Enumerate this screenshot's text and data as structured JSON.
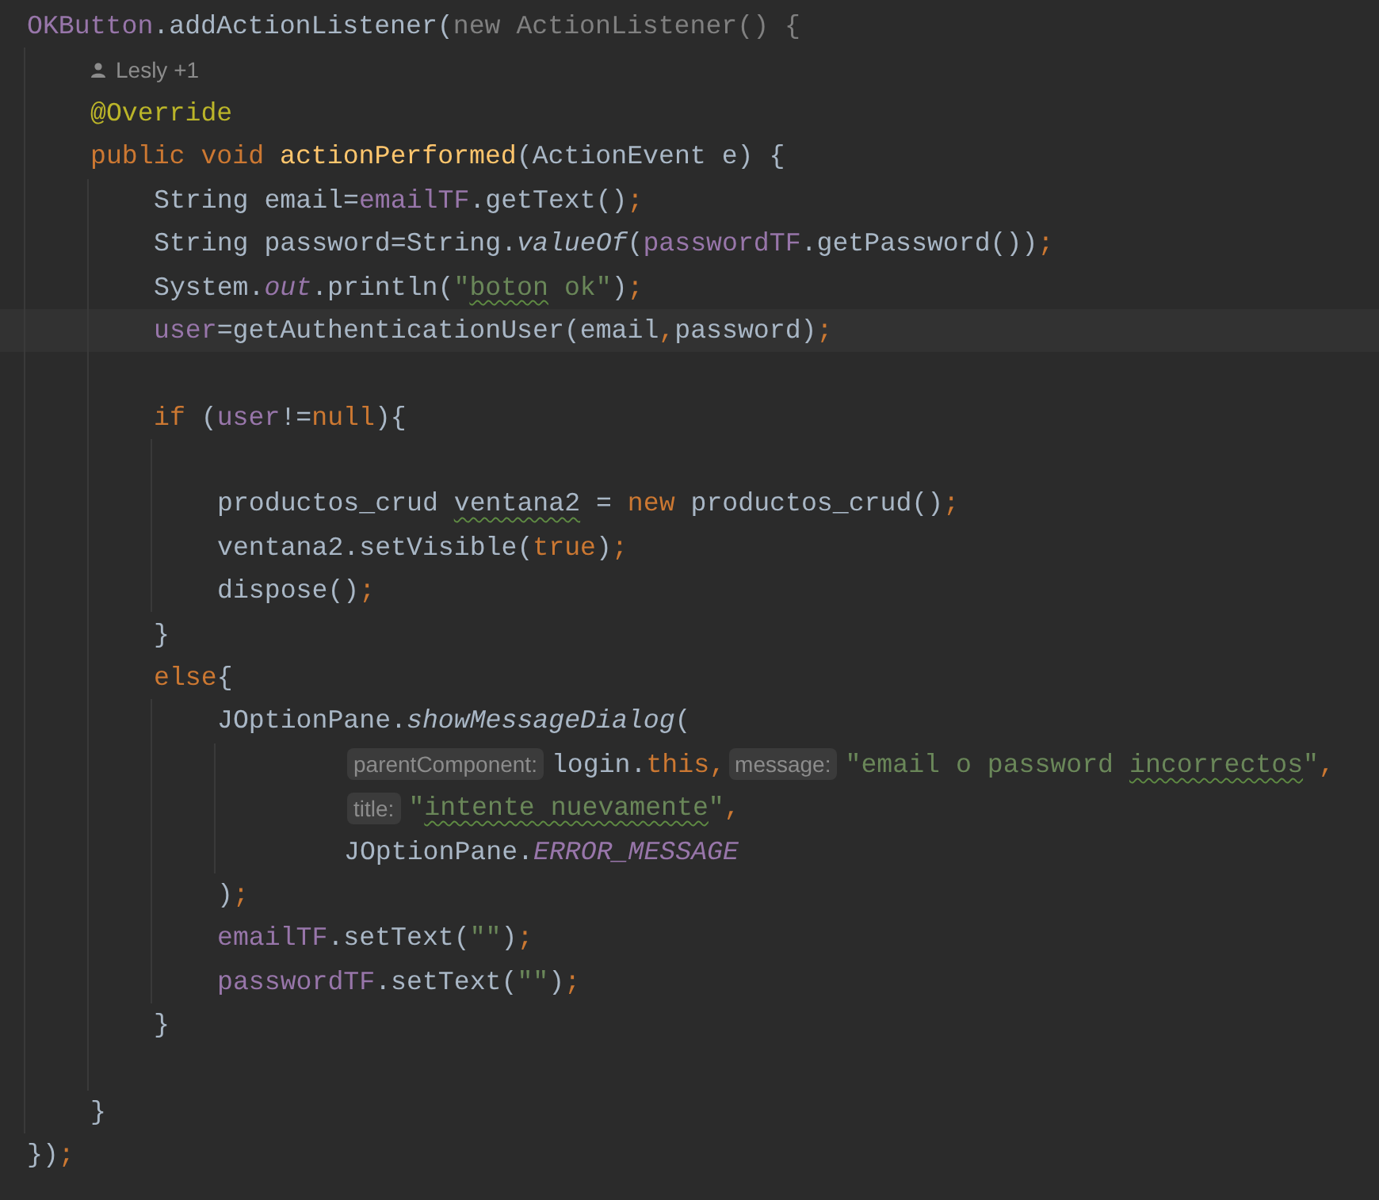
{
  "editor": {
    "lines": [
      {
        "kind": "line",
        "segments": [
          {
            "kind": "code",
            "tokens": [
              {
                "kind": "field",
                "text": "OKButton"
              },
              {
                "kind": "plain",
                "text": ".addActionListener("
              },
              {
                "kind": "muted",
                "text": "new ActionListener() {"
              }
            ]
          }
        ],
        "children": [
          {
            "kind": "line",
            "segments": [
              {
                "kind": "author",
                "text": "Lesly +1"
              }
            ]
          },
          {
            "kind": "line",
            "segments": [
              {
                "kind": "code",
                "tokens": [
                  {
                    "kind": "annotation",
                    "text": "@Override"
                  }
                ]
              }
            ]
          },
          {
            "kind": "line",
            "segments": [
              {
                "kind": "code",
                "tokens": [
                  {
                    "kind": "keyword",
                    "text": "public void "
                  },
                  {
                    "kind": "method",
                    "text": "actionPerformed"
                  },
                  {
                    "kind": "plain",
                    "text": "(ActionEvent e) {"
                  }
                ]
              }
            ],
            "children": [
              {
                "kind": "line",
                "segments": [
                  {
                    "kind": "code",
                    "tokens": [
                      {
                        "kind": "plain",
                        "text": "String email="
                      },
                      {
                        "kind": "field",
                        "text": "emailTF"
                      },
                      {
                        "kind": "plain",
                        "text": ".getText()"
                      },
                      {
                        "kind": "keyword",
                        "text": ";"
                      }
                    ]
                  }
                ]
              },
              {
                "kind": "line",
                "segments": [
                  {
                    "kind": "code",
                    "tokens": [
                      {
                        "kind": "plain",
                        "text": "String password=String."
                      },
                      {
                        "kind": "static",
                        "text": "valueOf"
                      },
                      {
                        "kind": "plain",
                        "text": "("
                      },
                      {
                        "kind": "field",
                        "text": "passwordTF"
                      },
                      {
                        "kind": "plain",
                        "text": ".getPassword())"
                      },
                      {
                        "kind": "keyword",
                        "text": ";"
                      }
                    ]
                  }
                ]
              },
              {
                "kind": "line",
                "segments": [
                  {
                    "kind": "code",
                    "tokens": [
                      {
                        "kind": "plain",
                        "text": "System."
                      },
                      {
                        "kind": "static-field",
                        "text": "out"
                      },
                      {
                        "kind": "plain",
                        "text": ".println("
                      },
                      {
                        "kind": "string",
                        "text": "\""
                      },
                      {
                        "kind": "typo-string",
                        "text": "boton"
                      },
                      {
                        "kind": "string",
                        "text": " ok\""
                      },
                      {
                        "kind": "plain",
                        "text": ")"
                      },
                      {
                        "kind": "keyword",
                        "text": ";"
                      }
                    ]
                  }
                ]
              },
              {
                "kind": "line",
                "current": true,
                "segments": [
                  {
                    "kind": "code",
                    "tokens": [
                      {
                        "kind": "field",
                        "text": "user"
                      },
                      {
                        "kind": "plain",
                        "text": "=getAuthenticationUser(email"
                      },
                      {
                        "kind": "keyword",
                        "text": ","
                      },
                      {
                        "kind": "plain",
                        "text": "password)"
                      },
                      {
                        "kind": "keyword",
                        "text": ";"
                      }
                    ]
                  }
                ]
              },
              {
                "kind": "blank"
              },
              {
                "kind": "line",
                "segments": [
                  {
                    "kind": "code",
                    "tokens": [
                      {
                        "kind": "keyword",
                        "text": "if "
                      },
                      {
                        "kind": "plain",
                        "text": "("
                      },
                      {
                        "kind": "field",
                        "text": "user"
                      },
                      {
                        "kind": "plain",
                        "text": "!="
                      },
                      {
                        "kind": "keyword",
                        "text": "null"
                      },
                      {
                        "kind": "plain",
                        "text": "){"
                      }
                    ]
                  }
                ],
                "children": [
                  {
                    "kind": "blank"
                  },
                  {
                    "kind": "line",
                    "segments": [
                      {
                        "kind": "code",
                        "tokens": [
                          {
                            "kind": "plain",
                            "text": "productos_crud "
                          },
                          {
                            "kind": "typo-plain",
                            "text": "ventana2"
                          },
                          {
                            "kind": "plain",
                            "text": " = "
                          },
                          {
                            "kind": "keyword",
                            "text": "new "
                          },
                          {
                            "kind": "plain",
                            "text": "productos_crud()"
                          },
                          {
                            "kind": "keyword",
                            "text": ";"
                          }
                        ]
                      }
                    ]
                  },
                  {
                    "kind": "line",
                    "segments": [
                      {
                        "kind": "code",
                        "tokens": [
                          {
                            "kind": "plain",
                            "text": "ventana2.setVisible("
                          },
                          {
                            "kind": "keyword",
                            "text": "true"
                          },
                          {
                            "kind": "plain",
                            "text": ")"
                          },
                          {
                            "kind": "keyword",
                            "text": ";"
                          }
                        ]
                      }
                    ]
                  },
                  {
                    "kind": "line",
                    "segments": [
                      {
                        "kind": "code",
                        "tokens": [
                          {
                            "kind": "plain",
                            "text": "dispose()"
                          },
                          {
                            "kind": "keyword",
                            "text": ";"
                          }
                        ]
                      }
                    ]
                  }
                ]
              },
              {
                "kind": "line",
                "segments": [
                  {
                    "kind": "code",
                    "tokens": [
                      {
                        "kind": "plain",
                        "text": "}"
                      }
                    ]
                  }
                ]
              },
              {
                "kind": "line",
                "segments": [
                  {
                    "kind": "code",
                    "tokens": [
                      {
                        "kind": "keyword",
                        "text": "else"
                      },
                      {
                        "kind": "plain",
                        "text": "{"
                      }
                    ]
                  }
                ],
                "children": [
                  {
                    "kind": "line",
                    "segments": [
                      {
                        "kind": "code",
                        "tokens": [
                          {
                            "kind": "plain",
                            "text": "JOptionPane."
                          },
                          {
                            "kind": "static",
                            "text": "showMessageDialog"
                          },
                          {
                            "kind": "plain",
                            "text": "("
                          }
                        ]
                      }
                    ],
                    "children": [
                      {
                        "kind": "group",
                        "children": [
                          {
                            "kind": "line",
                            "segments": [
                              {
                                "kind": "hint",
                                "text": "parentComponent:"
                              },
                              {
                                "kind": "code",
                                "tokens": [
                                  {
                                    "kind": "plain",
                                    "text": "login."
                                  },
                                  {
                                    "kind": "keyword",
                                    "text": "this"
                                  },
                                  {
                                    "kind": "keyword",
                                    "text": ","
                                  }
                                ]
                              },
                              {
                                "kind": "hint",
                                "text": "message:"
                              },
                              {
                                "kind": "code",
                                "tokens": [
                                  {
                                    "kind": "string",
                                    "text": "\"email o password "
                                  },
                                  {
                                    "kind": "typo-string",
                                    "text": "incorrectos"
                                  },
                                  {
                                    "kind": "string",
                                    "text": "\""
                                  },
                                  {
                                    "kind": "keyword",
                                    "text": ","
                                  }
                                ]
                              }
                            ]
                          },
                          {
                            "kind": "line",
                            "segments": [
                              {
                                "kind": "hint",
                                "text": "title:"
                              },
                              {
                                "kind": "code",
                                "tokens": [
                                  {
                                    "kind": "string",
                                    "text": "\""
                                  },
                                  {
                                    "kind": "typo-string",
                                    "text": "intente"
                                  },
                                  {
                                    "kind": "typo-string",
                                    "text": " nuevamente"
                                  },
                                  {
                                    "kind": "string",
                                    "text": "\""
                                  },
                                  {
                                    "kind": "keyword",
                                    "text": ","
                                  }
                                ]
                              }
                            ]
                          },
                          {
                            "kind": "line",
                            "segments": [
                              {
                                "kind": "code",
                                "tokens": [
                                  {
                                    "kind": "plain",
                                    "text": "JOptionPane."
                                  },
                                  {
                                    "kind": "static-field",
                                    "text": "ERROR_MESSAGE"
                                  }
                                ]
                              }
                            ]
                          }
                        ]
                      }
                    ]
                  },
                  {
                    "kind": "line",
                    "segments": [
                      {
                        "kind": "code",
                        "tokens": [
                          {
                            "kind": "plain",
                            "text": ")"
                          },
                          {
                            "kind": "keyword",
                            "text": ";"
                          }
                        ]
                      }
                    ]
                  },
                  {
                    "kind": "line",
                    "segments": [
                      {
                        "kind": "code",
                        "tokens": [
                          {
                            "kind": "field",
                            "text": "emailTF"
                          },
                          {
                            "kind": "plain",
                            "text": ".setText("
                          },
                          {
                            "kind": "string",
                            "text": "\"\""
                          },
                          {
                            "kind": "plain",
                            "text": ")"
                          },
                          {
                            "kind": "keyword",
                            "text": ";"
                          }
                        ]
                      }
                    ]
                  },
                  {
                    "kind": "line",
                    "segments": [
                      {
                        "kind": "code",
                        "tokens": [
                          {
                            "kind": "field",
                            "text": "passwordTF"
                          },
                          {
                            "kind": "plain",
                            "text": ".setText("
                          },
                          {
                            "kind": "string",
                            "text": "\"\""
                          },
                          {
                            "kind": "plain",
                            "text": ")"
                          },
                          {
                            "kind": "keyword",
                            "text": ";"
                          }
                        ]
                      }
                    ]
                  }
                ]
              },
              {
                "kind": "line",
                "segments": [
                  {
                    "kind": "code",
                    "tokens": [
                      {
                        "kind": "plain",
                        "text": "}"
                      }
                    ]
                  }
                ]
              },
              {
                "kind": "blank"
              }
            ]
          },
          {
            "kind": "line",
            "segments": [
              {
                "kind": "code",
                "tokens": [
                  {
                    "kind": "plain",
                    "text": "}"
                  }
                ]
              }
            ]
          }
        ]
      },
      {
        "kind": "line",
        "segments": [
          {
            "kind": "code",
            "tokens": [
              {
                "kind": "plain",
                "text": "})"
              },
              {
                "kind": "keyword",
                "text": ";"
              }
            ]
          }
        ]
      }
    ]
  }
}
